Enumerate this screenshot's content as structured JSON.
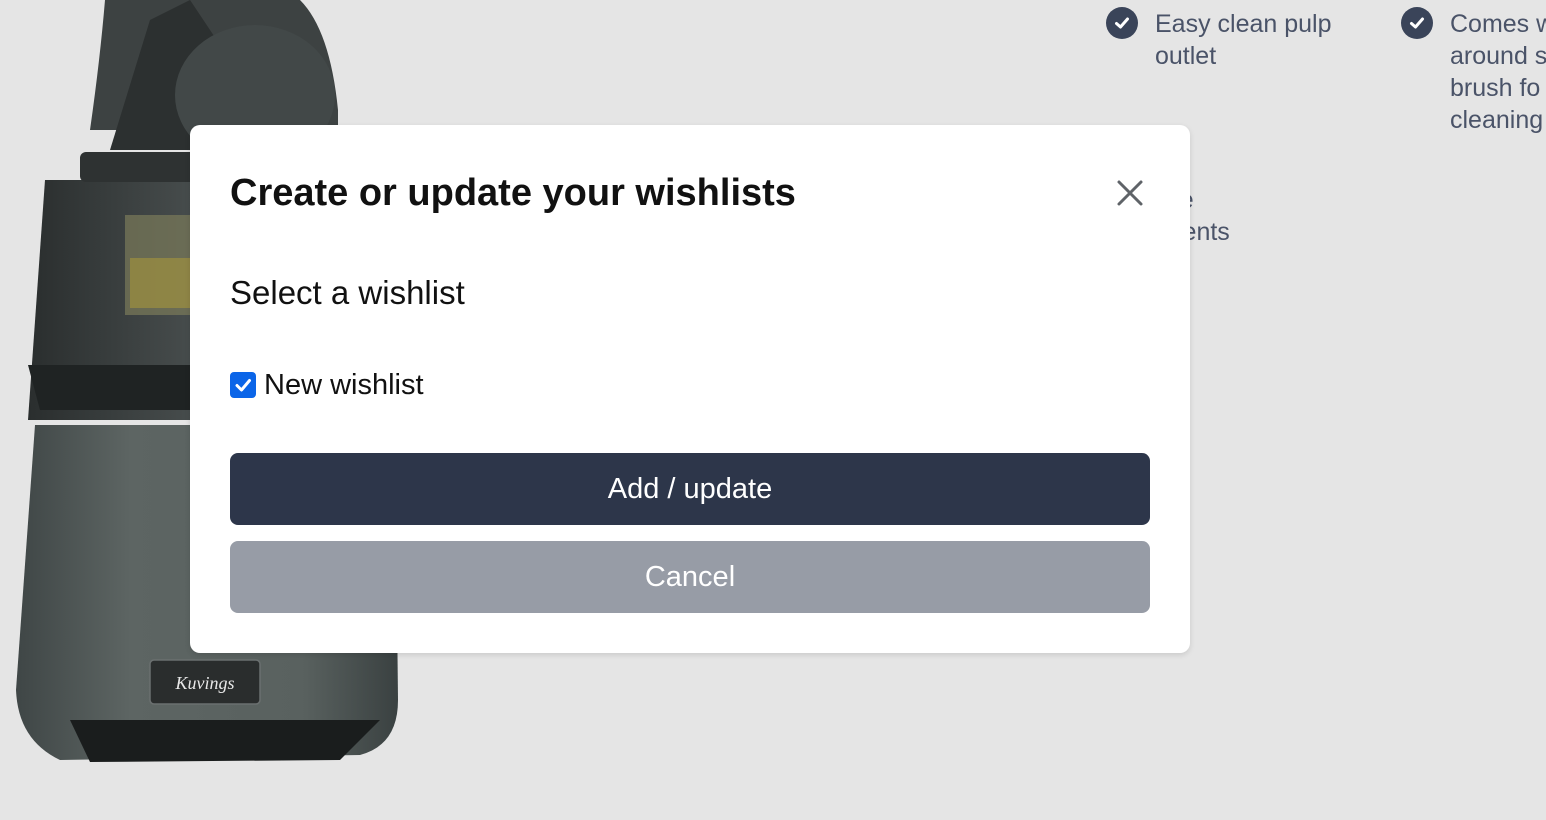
{
  "background": {
    "features": [
      {
        "text": "Easy clean pulp\noutlet",
        "icon": "check-circle-icon"
      },
      {
        "text": "Comes w\naround s\nbrush fo\ncleaning",
        "icon": "check-circle-icon"
      },
      {
        "text": "A Free\nmponents",
        "icon": "check-circle-icon"
      }
    ],
    "product_brand": "Kuvings"
  },
  "modal": {
    "title": "Create or update your wishlists",
    "close_icon": "close-icon",
    "section_label": "Select a wishlist",
    "wishlist_option": {
      "label": "New wishlist",
      "checked": true
    },
    "primary_button": "Add / update",
    "secondary_button": "Cancel"
  },
  "colors": {
    "page_background": "#e5e5e5",
    "primary_button": "#2d364a",
    "secondary_button": "#979ca6",
    "checkbox_accent": "#0b65e8",
    "feature_check": "#3a4459"
  }
}
